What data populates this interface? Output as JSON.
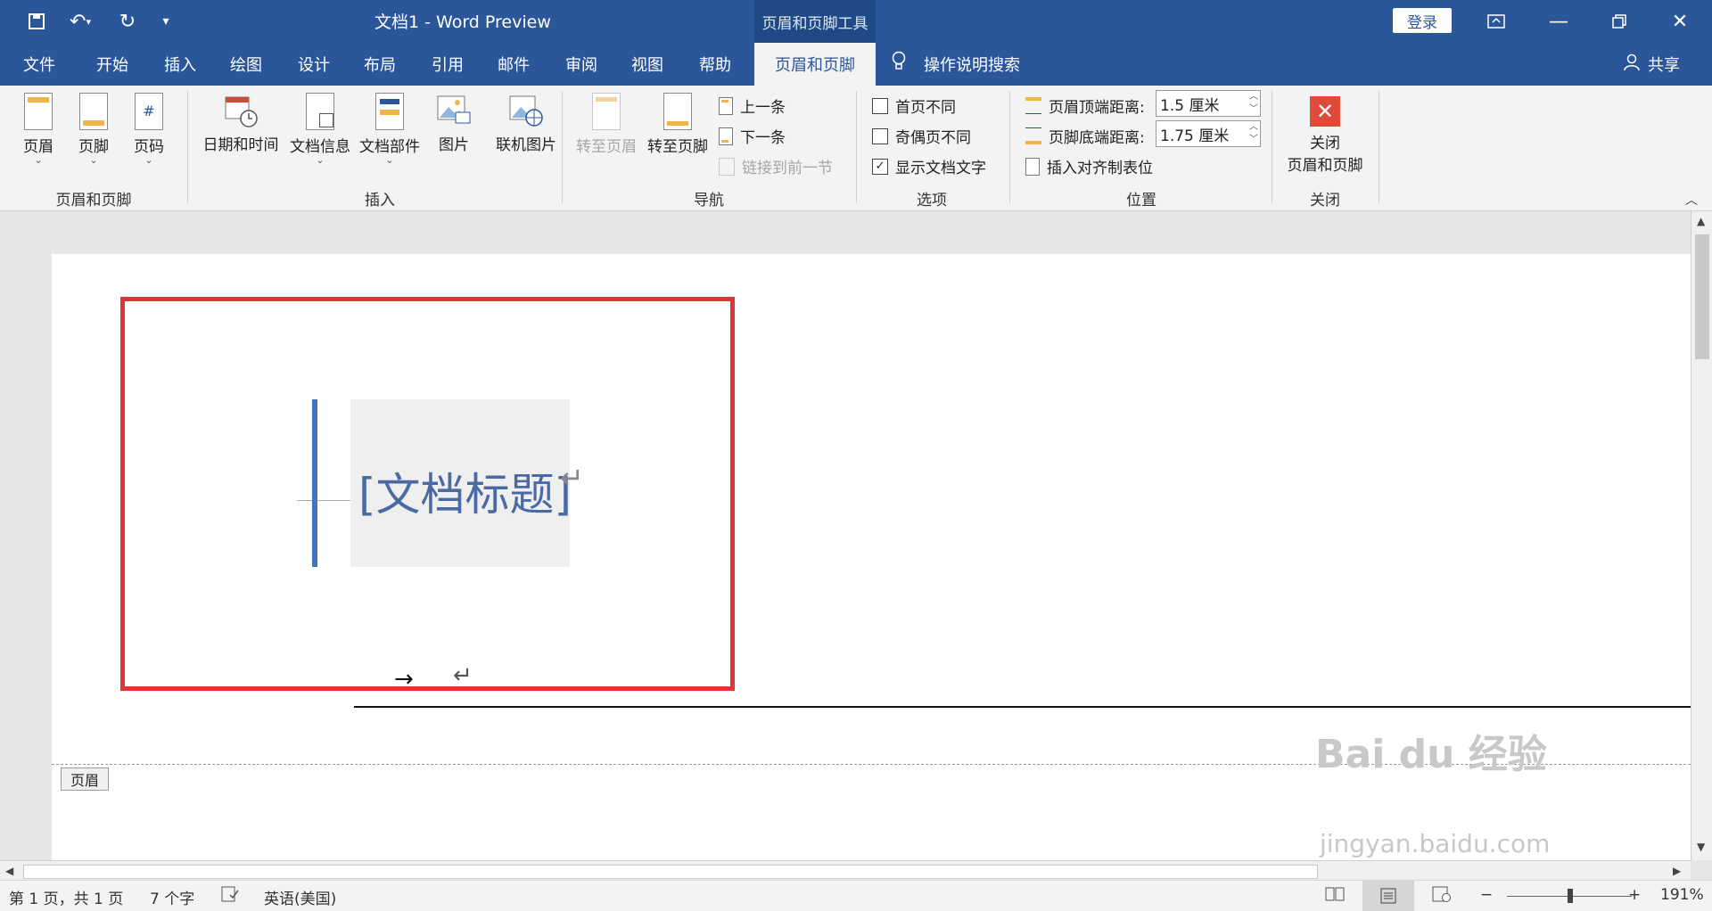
{
  "titlebar": {
    "doc_title": "文档1  -  Word Preview",
    "tools_tab": "页眉和页脚工具",
    "login": "登录"
  },
  "menu": {
    "items": [
      "文件",
      "开始",
      "插入",
      "绘图",
      "设计",
      "布局",
      "引用",
      "邮件",
      "审阅",
      "视图",
      "帮助",
      "页眉和页脚"
    ],
    "active": "页眉和页脚",
    "search": "操作说明搜索",
    "share": "共享"
  },
  "ribbon": {
    "g1": {
      "header": "页眉",
      "footer": "页脚",
      "page_number": "页码",
      "label": "页眉和页脚"
    },
    "g2": {
      "datetime": "日期和时间",
      "docinfo": "文档信息",
      "docparts": "文档部件",
      "picture": "图片",
      "online_picture": "联机图片",
      "label": "插入"
    },
    "g3": {
      "goto_header": "转至页眉",
      "goto_footer": "转至页脚",
      "prev": "上一条",
      "next": "下一条",
      "link_prev": "链接到前一节",
      "label": "导航"
    },
    "g4": {
      "first_diff": "首页不同",
      "oddeven_diff": "奇偶页不同",
      "show_doc_text": "显示文档文字",
      "label": "选项"
    },
    "g5": {
      "header_top": "页眉顶端距离:",
      "header_top_val": "1.5 厘米",
      "footer_bottom": "页脚底端距离:",
      "footer_bottom_val": "1.75 厘米",
      "insert_align_tab": "插入对齐制表位",
      "label": "位置"
    },
    "g6": {
      "close_line1": "关闭",
      "close_line2": "页眉和页脚",
      "label": "关闭"
    }
  },
  "document": {
    "title_placeholder": "[文档标题]",
    "para_mark": "↵",
    "tab_arrow": "→",
    "header_tag": "页眉"
  },
  "status": {
    "page": "第 1 页，共 1 页",
    "words": "7 个字",
    "lang": "英语(美国)",
    "zoom": "191%"
  },
  "watermark": {
    "logo": "Bai du 经验",
    "url": "jingyan.baidu.com"
  }
}
